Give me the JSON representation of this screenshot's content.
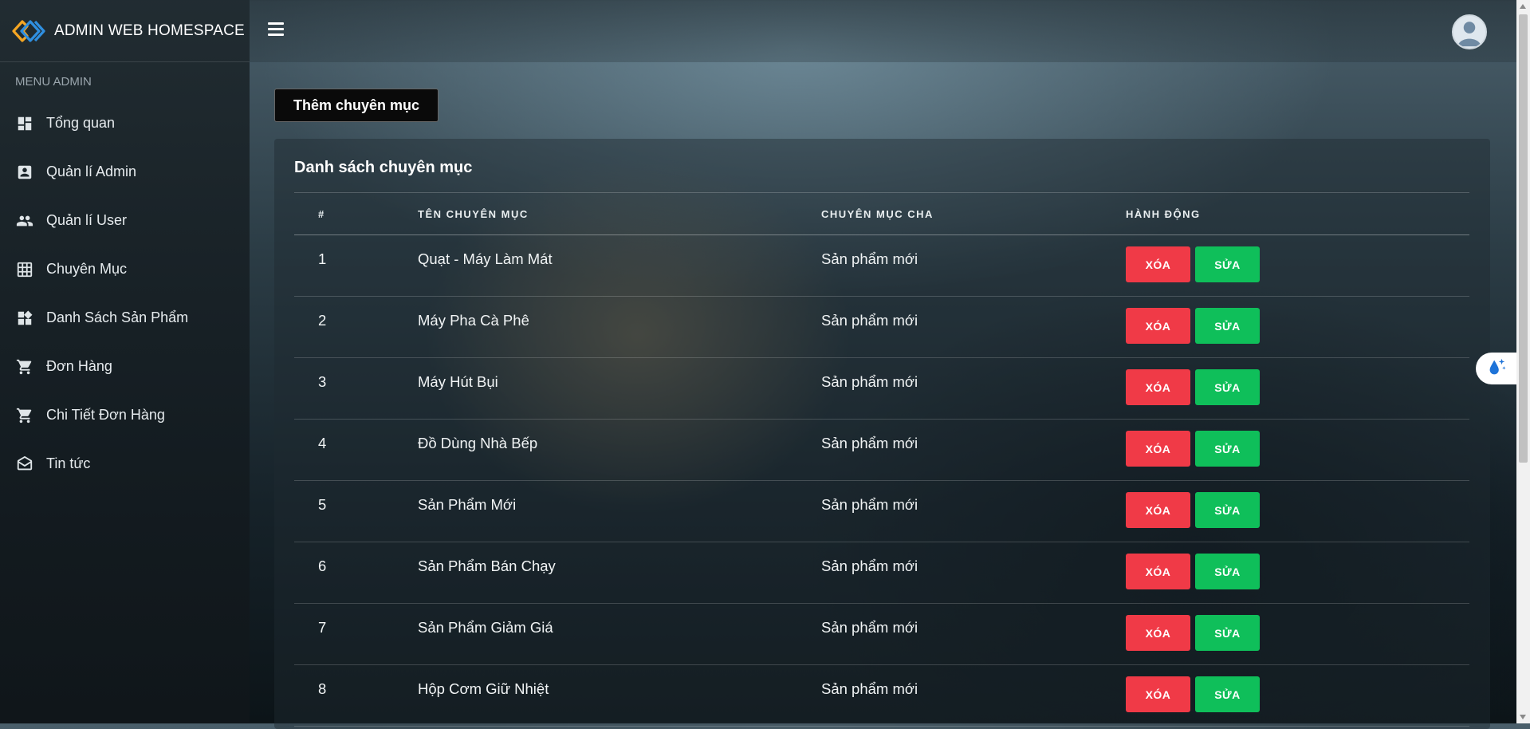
{
  "app": {
    "title": "ADMIN WEB HOMESPACE"
  },
  "sidebar": {
    "menu_title": "MENU ADMIN",
    "items": [
      {
        "label": "Tổng quan",
        "icon": "dashboard-icon"
      },
      {
        "label": "Quản lí Admin",
        "icon": "contact-card-icon"
      },
      {
        "label": "Quản lí User",
        "icon": "people-icon"
      },
      {
        "label": "Chuyên Mục",
        "icon": "grid-icon"
      },
      {
        "label": "Danh Sách Sản Phẩm",
        "icon": "widgets-icon"
      },
      {
        "label": "Đơn Hàng",
        "icon": "cart-icon"
      },
      {
        "label": "Chi Tiết Đơn Hàng",
        "icon": "cart-icon"
      },
      {
        "label": "Tin tức",
        "icon": "envelope-icon"
      }
    ]
  },
  "main": {
    "add_button": "Thêm chuyên mục",
    "card_title": "Danh sách chuyên mục",
    "columns": [
      "#",
      "TÊN CHUYÊN MỤC",
      "CHUYÊN MỤC CHA",
      "HÀNH ĐỘNG"
    ],
    "delete_label": "XÓA",
    "edit_label": "SỬA",
    "rows": [
      {
        "id": "1",
        "name": "Quạt - Máy Làm Mát",
        "parent": "Sản phẩm mới"
      },
      {
        "id": "2",
        "name": "Máy Pha Cà Phê",
        "parent": "Sản phẩm mới"
      },
      {
        "id": "3",
        "name": "Máy Hút Bụi",
        "parent": "Sản phẩm mới"
      },
      {
        "id": "4",
        "name": "Đồ Dùng Nhà Bếp",
        "parent": "Sản phẩm mới"
      },
      {
        "id": "5",
        "name": "Sản Phẩm Mới",
        "parent": "Sản phẩm mới"
      },
      {
        "id": "6",
        "name": "Sản Phẩm Bán Chạy",
        "parent": "Sản phẩm mới"
      },
      {
        "id": "7",
        "name": "Sản Phẩm Giảm Giá",
        "parent": "Sản phẩm mới"
      },
      {
        "id": "8",
        "name": "Hộp Cơm Giữ Nhiệt",
        "parent": "Sản phẩm mới"
      }
    ]
  },
  "colors": {
    "delete": "#f03a47",
    "edit": "#0fbf5a",
    "logo_orange": "#f5a623",
    "logo_blue": "#2f8fe0"
  }
}
